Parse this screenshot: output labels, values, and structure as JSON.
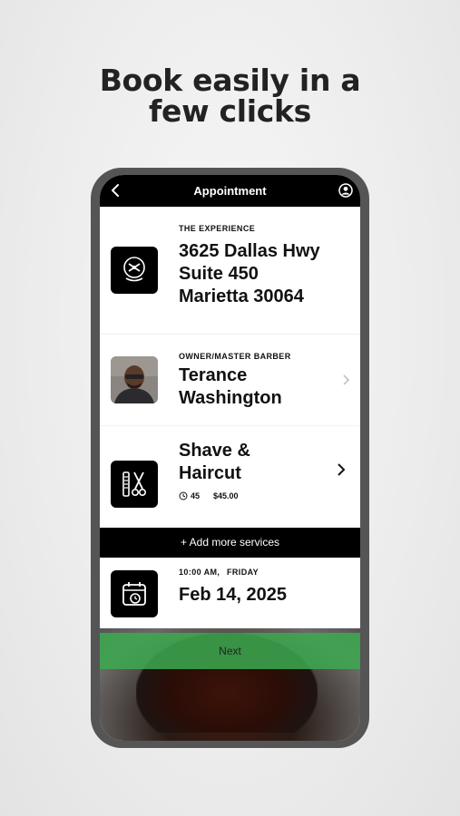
{
  "headline": {
    "line1": "Book easily in a",
    "line2": "few clicks"
  },
  "topbar": {
    "title": "Appointment",
    "back_icon": "chevron-left-icon",
    "profile_icon": "user-circle-icon"
  },
  "location": {
    "label": "THE EXPERIENCE",
    "line1": "3625 Dallas Hwy",
    "line2": "Suite 450",
    "line3": "Marietta 30064",
    "icon": "barber-logo-icon"
  },
  "barber": {
    "label": "OWNER/MASTER BARBER",
    "first": "Terance",
    "last": "Washington"
  },
  "service": {
    "line1": "Shave &",
    "line2": "Haircut",
    "duration": "45",
    "price": "$45.00",
    "icon": "comb-scissors-icon"
  },
  "add_services": "+ Add more services",
  "datetime": {
    "time": "10:00 AM,",
    "day": "FRIDAY",
    "date": "Feb 14, 2025",
    "icon": "calendar-icon"
  },
  "next_label": "Next"
}
